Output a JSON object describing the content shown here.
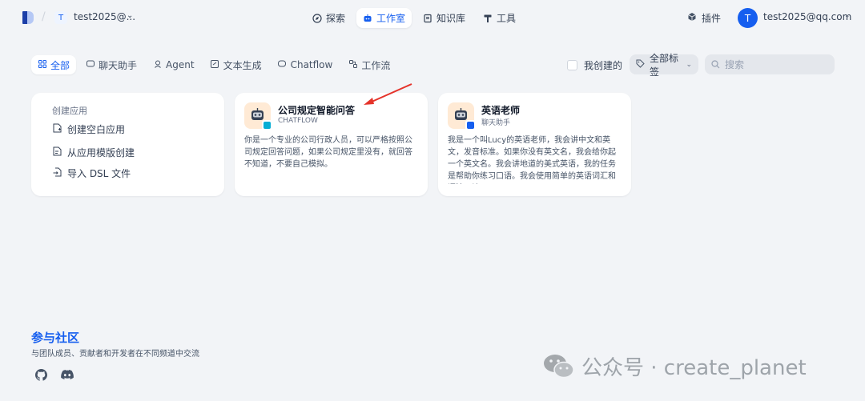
{
  "header": {
    "workspace_initial": "T",
    "workspace_name": "test2025@...",
    "nav": [
      {
        "label": "探索",
        "icon": "compass-icon",
        "active": false
      },
      {
        "label": "工作室",
        "icon": "robot-icon",
        "active": true
      },
      {
        "label": "知识库",
        "icon": "book-icon",
        "active": false
      },
      {
        "label": "工具",
        "icon": "hammer-icon",
        "active": false
      }
    ],
    "plugin_label": "插件",
    "user_initial": "T",
    "user_email": "test2025@qq.com"
  },
  "filters": {
    "tabs": [
      {
        "label": "全部",
        "icon": "grid-icon",
        "active": true
      },
      {
        "label": "聊天助手",
        "icon": "chat-icon",
        "active": false
      },
      {
        "label": "Agent",
        "icon": "agent-icon",
        "active": false
      },
      {
        "label": "文本生成",
        "icon": "text-icon",
        "active": false
      },
      {
        "label": "Chatflow",
        "icon": "chatflow-icon",
        "active": false
      },
      {
        "label": "工作流",
        "icon": "workflow-icon",
        "active": false
      }
    ],
    "mine_label": "我创建的",
    "tags_label": "全部标签",
    "search_placeholder": "搜索"
  },
  "create_card": {
    "title": "创建应用",
    "items": [
      {
        "label": "创建空白应用",
        "icon": "file-plus-icon"
      },
      {
        "label": "从应用模版创建",
        "icon": "template-icon"
      },
      {
        "label": "导入 DSL 文件",
        "icon": "import-icon"
      }
    ]
  },
  "apps": [
    {
      "name": "公司规定智能问答",
      "type": "CHATFLOW",
      "description": "你是一个专业的公司行政人员，可以严格按照公司规定回答问题，如果公司规定里没有，就回答不知道，不要自己模拟。",
      "badge_color": "#06aed4"
    },
    {
      "name": "英语老师",
      "type": "聊天助手",
      "description": "我是一个叫Lucy的英语老师，我会讲中文和英文，发音标准。如果你没有英文名，我会给你起一个英文名。我会讲地道的美式英语，我的任务是帮助你练习口语。我会使用简单的英语词汇和语法，让...",
      "badge_color": "#155eef"
    }
  ],
  "community": {
    "title": "参与社区",
    "subtitle": "与团队成员、贡献者和开发者在不同频道中交流"
  },
  "watermark": "公众号 · create_planet"
}
